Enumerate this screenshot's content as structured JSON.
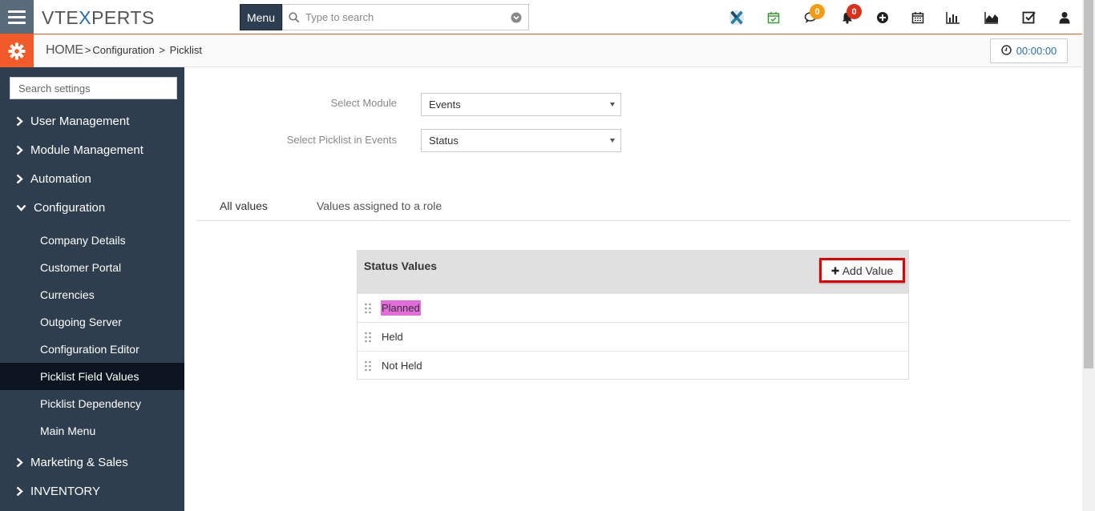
{
  "topbar": {
    "logo_prefix": "VTE",
    "logo_x": "X",
    "logo_suffix": "PERTS",
    "menu_label": "Menu",
    "search_placeholder": "Type to search",
    "badges": {
      "chat": "0",
      "notifications": "0"
    },
    "icons": [
      "vtexperts-x-icon",
      "calendar-check-icon",
      "chat-icon",
      "bell-icon",
      "plus-circle-icon",
      "calendar-icon",
      "bar-chart-icon",
      "area-chart-icon",
      "checkbox-icon",
      "user-icon"
    ]
  },
  "subbar": {
    "home": "HOME",
    "crumb_1": "Configuration",
    "crumb_2": "Picklist",
    "timer": "00:00:00"
  },
  "sidebar": {
    "search_placeholder": "Search settings",
    "items": [
      {
        "label": "User Management"
      },
      {
        "label": "Module Management"
      },
      {
        "label": "Automation"
      },
      {
        "label": "Configuration"
      }
    ],
    "sub_items": [
      {
        "label": "Company Details"
      },
      {
        "label": "Customer Portal"
      },
      {
        "label": "Currencies"
      },
      {
        "label": "Outgoing Server"
      },
      {
        "label": "Configuration Editor"
      },
      {
        "label": "Picklist Field Values"
      },
      {
        "label": "Picklist Dependency"
      },
      {
        "label": "Main Menu"
      }
    ],
    "items_after": [
      {
        "label": "Marketing & Sales"
      },
      {
        "label": "INVENTORY"
      }
    ]
  },
  "form": {
    "module_label": "Select Module",
    "module_value": "Events",
    "picklist_label": "Select Picklist in Events",
    "picklist_value": "Status"
  },
  "tabs": {
    "all_values": "All values",
    "role_values": "Values assigned to a role"
  },
  "panel": {
    "title": "Status Values",
    "add_label": "Add Value",
    "values": [
      "Planned",
      "Held",
      "Not Held"
    ]
  },
  "colors": {
    "accent": "#f15a29",
    "sidebar": "#2f3e4e",
    "active_sidebar": "#0d1620",
    "highlight": "#e36bdb",
    "add_border": "#e00000",
    "link_blue": "#2a6db0"
  }
}
